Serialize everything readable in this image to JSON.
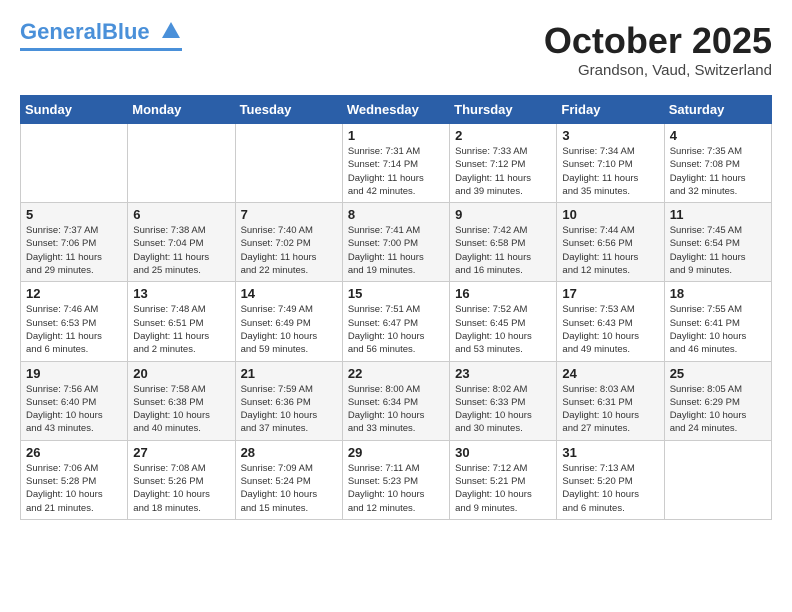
{
  "header": {
    "logo_general": "General",
    "logo_blue": "Blue",
    "month_title": "October 2025",
    "location": "Grandson, Vaud, Switzerland"
  },
  "days_of_week": [
    "Sunday",
    "Monday",
    "Tuesday",
    "Wednesday",
    "Thursday",
    "Friday",
    "Saturday"
  ],
  "weeks": [
    [
      {
        "day": "",
        "info": ""
      },
      {
        "day": "",
        "info": ""
      },
      {
        "day": "",
        "info": ""
      },
      {
        "day": "1",
        "info": "Sunrise: 7:31 AM\nSunset: 7:14 PM\nDaylight: 11 hours\nand 42 minutes."
      },
      {
        "day": "2",
        "info": "Sunrise: 7:33 AM\nSunset: 7:12 PM\nDaylight: 11 hours\nand 39 minutes."
      },
      {
        "day": "3",
        "info": "Sunrise: 7:34 AM\nSunset: 7:10 PM\nDaylight: 11 hours\nand 35 minutes."
      },
      {
        "day": "4",
        "info": "Sunrise: 7:35 AM\nSunset: 7:08 PM\nDaylight: 11 hours\nand 32 minutes."
      }
    ],
    [
      {
        "day": "5",
        "info": "Sunrise: 7:37 AM\nSunset: 7:06 PM\nDaylight: 11 hours\nand 29 minutes."
      },
      {
        "day": "6",
        "info": "Sunrise: 7:38 AM\nSunset: 7:04 PM\nDaylight: 11 hours\nand 25 minutes."
      },
      {
        "day": "7",
        "info": "Sunrise: 7:40 AM\nSunset: 7:02 PM\nDaylight: 11 hours\nand 22 minutes."
      },
      {
        "day": "8",
        "info": "Sunrise: 7:41 AM\nSunset: 7:00 PM\nDaylight: 11 hours\nand 19 minutes."
      },
      {
        "day": "9",
        "info": "Sunrise: 7:42 AM\nSunset: 6:58 PM\nDaylight: 11 hours\nand 16 minutes."
      },
      {
        "day": "10",
        "info": "Sunrise: 7:44 AM\nSunset: 6:56 PM\nDaylight: 11 hours\nand 12 minutes."
      },
      {
        "day": "11",
        "info": "Sunrise: 7:45 AM\nSunset: 6:54 PM\nDaylight: 11 hours\nand 9 minutes."
      }
    ],
    [
      {
        "day": "12",
        "info": "Sunrise: 7:46 AM\nSunset: 6:53 PM\nDaylight: 11 hours\nand 6 minutes."
      },
      {
        "day": "13",
        "info": "Sunrise: 7:48 AM\nSunset: 6:51 PM\nDaylight: 11 hours\nand 2 minutes."
      },
      {
        "day": "14",
        "info": "Sunrise: 7:49 AM\nSunset: 6:49 PM\nDaylight: 10 hours\nand 59 minutes."
      },
      {
        "day": "15",
        "info": "Sunrise: 7:51 AM\nSunset: 6:47 PM\nDaylight: 10 hours\nand 56 minutes."
      },
      {
        "day": "16",
        "info": "Sunrise: 7:52 AM\nSunset: 6:45 PM\nDaylight: 10 hours\nand 53 minutes."
      },
      {
        "day": "17",
        "info": "Sunrise: 7:53 AM\nSunset: 6:43 PM\nDaylight: 10 hours\nand 49 minutes."
      },
      {
        "day": "18",
        "info": "Sunrise: 7:55 AM\nSunset: 6:41 PM\nDaylight: 10 hours\nand 46 minutes."
      }
    ],
    [
      {
        "day": "19",
        "info": "Sunrise: 7:56 AM\nSunset: 6:40 PM\nDaylight: 10 hours\nand 43 minutes."
      },
      {
        "day": "20",
        "info": "Sunrise: 7:58 AM\nSunset: 6:38 PM\nDaylight: 10 hours\nand 40 minutes."
      },
      {
        "day": "21",
        "info": "Sunrise: 7:59 AM\nSunset: 6:36 PM\nDaylight: 10 hours\nand 37 minutes."
      },
      {
        "day": "22",
        "info": "Sunrise: 8:00 AM\nSunset: 6:34 PM\nDaylight: 10 hours\nand 33 minutes."
      },
      {
        "day": "23",
        "info": "Sunrise: 8:02 AM\nSunset: 6:33 PM\nDaylight: 10 hours\nand 30 minutes."
      },
      {
        "day": "24",
        "info": "Sunrise: 8:03 AM\nSunset: 6:31 PM\nDaylight: 10 hours\nand 27 minutes."
      },
      {
        "day": "25",
        "info": "Sunrise: 8:05 AM\nSunset: 6:29 PM\nDaylight: 10 hours\nand 24 minutes."
      }
    ],
    [
      {
        "day": "26",
        "info": "Sunrise: 7:06 AM\nSunset: 5:28 PM\nDaylight: 10 hours\nand 21 minutes."
      },
      {
        "day": "27",
        "info": "Sunrise: 7:08 AM\nSunset: 5:26 PM\nDaylight: 10 hours\nand 18 minutes."
      },
      {
        "day": "28",
        "info": "Sunrise: 7:09 AM\nSunset: 5:24 PM\nDaylight: 10 hours\nand 15 minutes."
      },
      {
        "day": "29",
        "info": "Sunrise: 7:11 AM\nSunset: 5:23 PM\nDaylight: 10 hours\nand 12 minutes."
      },
      {
        "day": "30",
        "info": "Sunrise: 7:12 AM\nSunset: 5:21 PM\nDaylight: 10 hours\nand 9 minutes."
      },
      {
        "day": "31",
        "info": "Sunrise: 7:13 AM\nSunset: 5:20 PM\nDaylight: 10 hours\nand 6 minutes."
      },
      {
        "day": "",
        "info": ""
      }
    ]
  ]
}
